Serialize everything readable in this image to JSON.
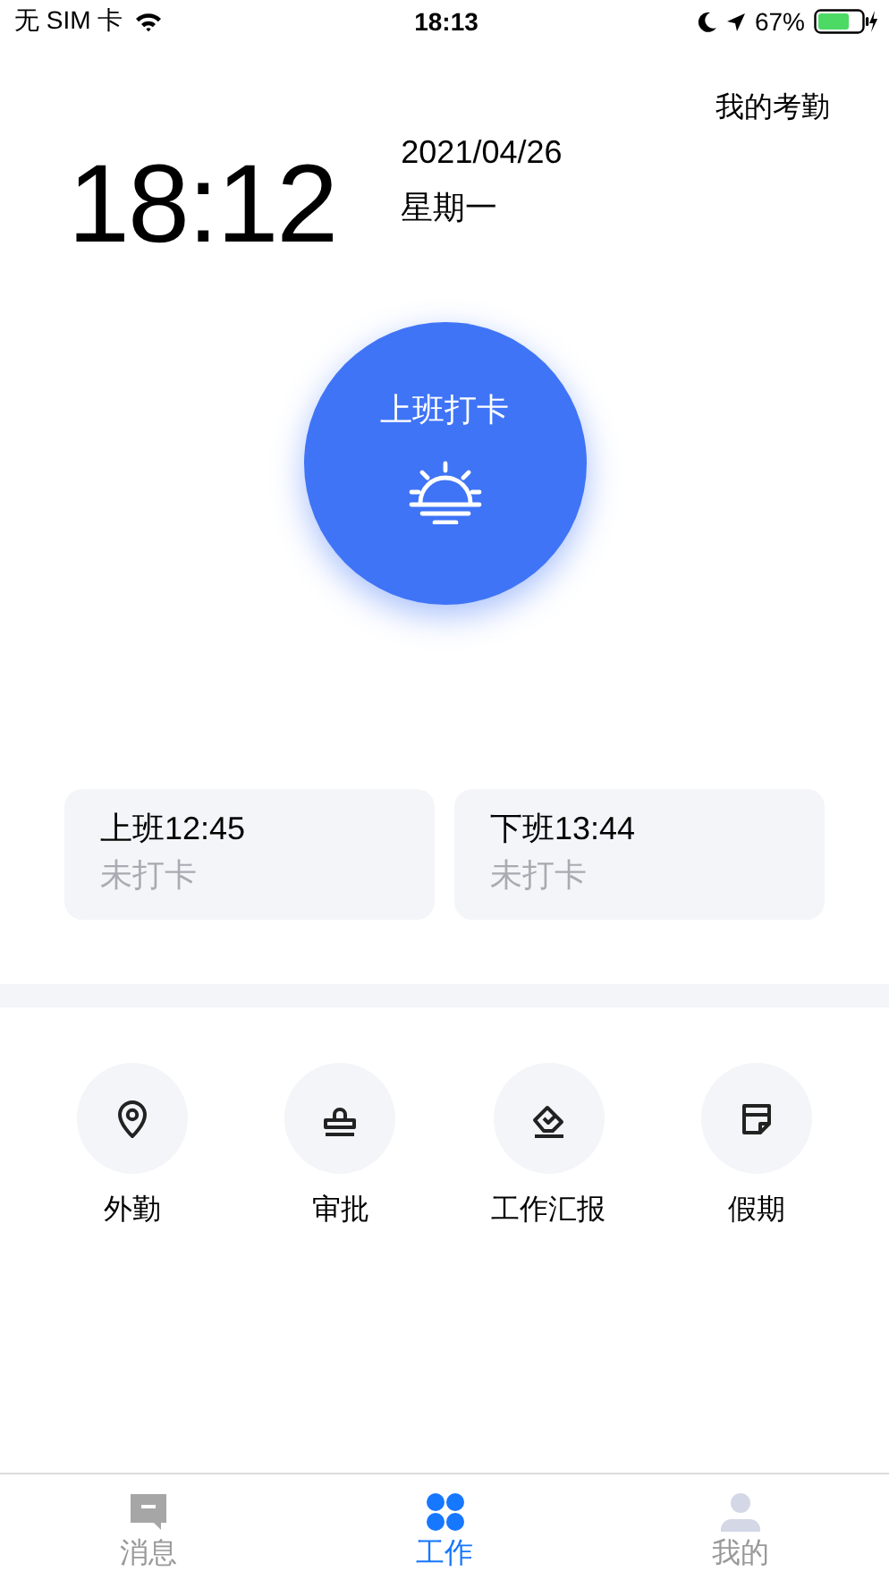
{
  "status_bar": {
    "carrier": "无 SIM 卡",
    "time": "18:13",
    "battery": "67%"
  },
  "header": {
    "link": "我的考勤"
  },
  "clock": {
    "time": "18:12",
    "date": "2021/04/26",
    "weekday": "星期一"
  },
  "punch_button": {
    "label": "上班打卡"
  },
  "shifts": [
    {
      "title": "上班12:45",
      "status": "未打卡"
    },
    {
      "title": "下班13:44",
      "status": "未打卡"
    }
  ],
  "actions": [
    {
      "kind": "location",
      "label": "外勤"
    },
    {
      "kind": "stamp",
      "label": "审批"
    },
    {
      "kind": "report",
      "label": "工作汇报"
    },
    {
      "kind": "calendar",
      "label": "假期"
    }
  ],
  "tabs": [
    {
      "kind": "message",
      "label": "消息",
      "selected": false
    },
    {
      "kind": "grid",
      "label": "工作",
      "selected": true
    },
    {
      "kind": "person",
      "label": "我的",
      "selected": false
    }
  ]
}
